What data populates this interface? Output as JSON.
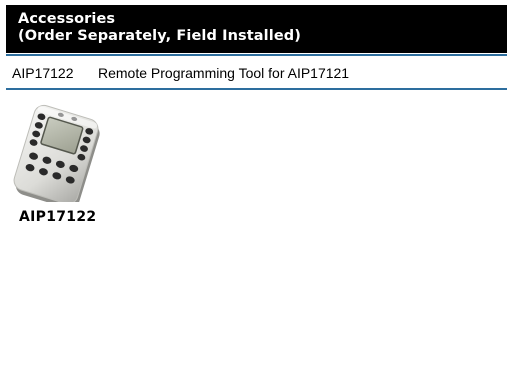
{
  "header": {
    "line1": "Accessories",
    "line2": "(Order Separately, Field Installed)"
  },
  "accessory": {
    "code": "AIP17122",
    "description": "Remote Programming Tool for AIP17121"
  },
  "product_image": {
    "icon": "remote-programming-tool-icon",
    "caption": "AIP17122"
  },
  "colors": {
    "header_background": "#000000",
    "header_text": "#ffffff",
    "rule": "#2d6e9e"
  }
}
